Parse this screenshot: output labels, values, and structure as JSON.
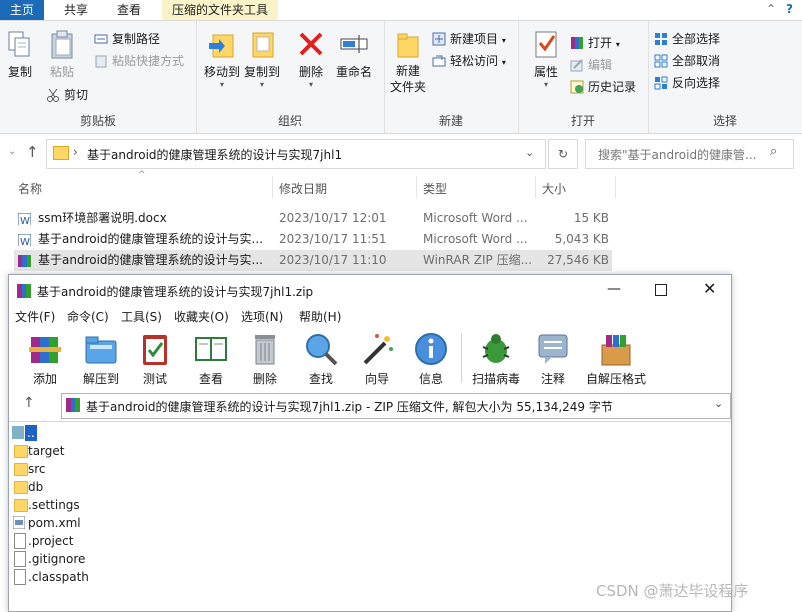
{
  "explorer": {
    "tabs": [
      "主页",
      "共享",
      "查看",
      "压缩的文件夹工具"
    ],
    "ribbon": {
      "clipboard": {
        "copy": "复制",
        "paste": "粘贴",
        "copy_path": "复制路径",
        "paste_shortcut": "粘贴快捷方式",
        "cut": "剪切",
        "label": "剪贴板"
      },
      "organize": {
        "move_to": "移动到",
        "copy_to": "复制到",
        "delete": "删除",
        "rename": "重命名",
        "label": "组织"
      },
      "new": {
        "new_folder": "新建\n文件夹",
        "new_item": "新建项目",
        "easy_access": "轻松访问",
        "label": "新建"
      },
      "open": {
        "properties": "属性",
        "open": "打开",
        "edit": "编辑",
        "history": "历史记录",
        "label": "打开"
      },
      "select": {
        "select_all": "全部选择",
        "select_none": "全部取消",
        "invert": "反向选择",
        "label": "选择"
      }
    },
    "address": {
      "path": "基于android的健康管理系统的设计与实现7jhl1",
      "search_placeholder": "搜索\"基于android的健康管..."
    },
    "columns": {
      "name": "名称",
      "modified": "修改日期",
      "type": "类型",
      "size": "大小"
    },
    "files": [
      {
        "name": "ssm环境部署说明.docx",
        "modified": "2023/10/17 12:01",
        "type": "Microsoft Word ...",
        "size": "15 KB",
        "kind": "word"
      },
      {
        "name": "基于android的健康管理系统的设计与实...",
        "modified": "2023/10/17 11:51",
        "type": "Microsoft Word ...",
        "size": "5,043 KB",
        "kind": "word"
      },
      {
        "name": "基于android的健康管理系统的设计与实...",
        "modified": "2023/10/17 11:10",
        "type": "WinRAR ZIP 压缩...",
        "size": "27,546 KB",
        "kind": "rar"
      }
    ]
  },
  "winrar": {
    "title": "基于android的健康管理系统的设计与实现7jhl1.zip",
    "menu": [
      "文件(F)",
      "命令(C)",
      "工具(S)",
      "收藏夹(O)",
      "选项(N)",
      "帮助(H)"
    ],
    "toolbar": [
      "添加",
      "解压到",
      "测试",
      "查看",
      "删除",
      "查找",
      "向导",
      "信息",
      "扫描病毒",
      "注释",
      "自解压格式"
    ],
    "path_text": "基于android的健康管理系统的设计与实现7jhl1.zip - ZIP 压缩文件, 解包大小为 55,134,249 字节",
    "entries": [
      {
        "name": "..",
        "kind": "up"
      },
      {
        "name": "target",
        "kind": "folder"
      },
      {
        "name": "src",
        "kind": "folder"
      },
      {
        "name": "db",
        "kind": "folder"
      },
      {
        "name": ".settings",
        "kind": "folder"
      },
      {
        "name": "pom.xml",
        "kind": "xml"
      },
      {
        "name": ".project",
        "kind": "file"
      },
      {
        "name": ".gitignore",
        "kind": "file"
      },
      {
        "name": ".classpath",
        "kind": "file"
      }
    ]
  },
  "watermark": "CSDN @萧达毕设程序"
}
